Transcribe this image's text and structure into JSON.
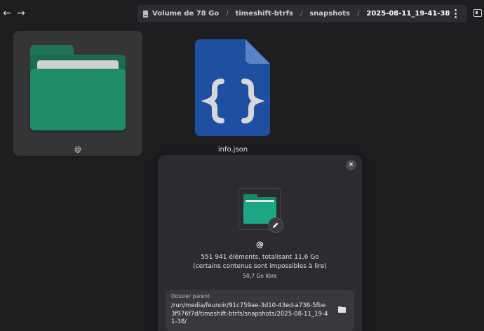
{
  "header": {
    "breadcrumb": [
      "Volume de 78 Go",
      "timeshift-btrfs",
      "snapshots",
      "2025-08-11_19-41-38"
    ],
    "separator": "/",
    "back_glyph": "←",
    "forward_glyph": "→"
  },
  "icons": {
    "back": "arrow-left-icon",
    "forward": "arrow-right-icon",
    "drive": "drive-icon",
    "more": "more-vertical-icon",
    "sidebar": "sidebar-toggle-icon",
    "close": "close-icon",
    "edit": "pencil-icon",
    "open_folder": "folder-open-icon"
  },
  "files": [
    {
      "name": "@",
      "kind": "folder",
      "selected": true
    },
    {
      "name": "info.json",
      "kind": "json"
    }
  ],
  "dialog": {
    "close_glyph": "×",
    "title": "@",
    "summary_line1": "551 941 éléments, totalisant 11,6 Go",
    "summary_line2": "(certains contenus sont impossibles à lire)",
    "free_space": "50,7 Go libre",
    "parent_label": "Dossier parent",
    "parent_path": "/run/media/feunoir/91c759ae-3d10-43ed-a736-5fbe3f976f7d/timeshift-btrfs/snapshots/2025-08-11_19-41-38/"
  },
  "colors": {
    "background": "#1e1e21",
    "folder_green": "#1f8d6a",
    "json_blue": "#1f4fa0",
    "dialog_bg": "#2b2b30"
  }
}
